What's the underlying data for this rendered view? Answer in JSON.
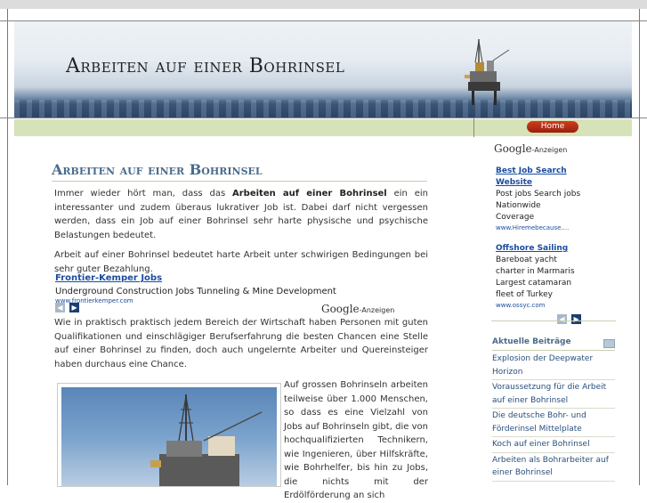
{
  "header": {
    "site_title": "Arbeiten auf einer Bohrinsel"
  },
  "nav": {
    "home_label": "Home"
  },
  "post": {
    "title": "Arbeiten auf einer Bohrinsel",
    "p1_before": "Immer wieder hört man, dass das ",
    "p1_bold": "Arbeiten auf einer Bohrinsel",
    "p1_after": " ein ein interessanter und zudem überaus lukrativer Job ist. Dabei darf nicht vergessen werden, dass ein Job auf einer Bohrinsel sehr harte physische und psychische Belastungen bedeutet.",
    "p2": "Arbeit auf einer Bohrinsel bedeutet harte Arbeit unter schwirigen Bedingungen bei sehr guter Bezahlung.",
    "p3": "Wie in praktisch praktisch jedem Bereich der Wirtschaft haben Personen mit guten Qualifikationen und einschlägiger Berufserfahrung die besten Chancen eine Stelle auf einer Bohrinsel zu finden, doch auch ungelernte Arbeiter und Quereinsteiger haben durchaus eine Chance.",
    "p4": "Auf grossen Bohrinseln arbeiten teilweise über 1.000 Menschen, so dass es eine Vielzahl von Jobs auf Bohrinseln gibt, die von hochqualifizierten Technikern, wie Ingenieren, über Hilfskräfte, wie Bohrhelfer, bis hin zu Jobs, die nichts mit der Erdölförderung an sich"
  },
  "inline_ad": {
    "title": "Frontier-Kemper Jobs",
    "description": "Underground Construction Jobs Tunneling & Mine Development",
    "url": "www.frontierkemper.com",
    "google_word": "Google",
    "google_suffix": "-Anzeigen"
  },
  "sidebar": {
    "google_word": "Google",
    "google_suffix": "-Anzeigen",
    "ads": [
      {
        "title": "Best Job Search Website",
        "desc": "Post jobs Search jobs Nationwide Coverage",
        "url": "www.Hiremebecause...."
      },
      {
        "title": "Offshore Sailing",
        "desc": "Bareboat yacht charter in Marmaris Largest catamaran fleet of Turkey",
        "url": "www.ossyc.com"
      }
    ],
    "recent_title": "Aktuelle Beiträge",
    "recent_posts": [
      "Explosion der Deepwater Horizon",
      "Voraussetzung für die Arbeit auf einer Bohrinsel",
      "Die deutsche Bohr- und Förderinsel Mittelplate",
      "Koch auf einer Bohrinsel",
      "Arbeiten als Bohrarbeiter auf einer Bohrinsel"
    ]
  },
  "colors": {
    "nav_bg": "#d6e2b7",
    "home_button": "#c0311a",
    "title_blue": "#4a6b8a",
    "link_blue": "#1a4c9e",
    "arrow_box": "#1d3d72"
  },
  "icons": {
    "prev": "chevron-left-icon",
    "next": "chevron-right-icon",
    "rss": "feed-icon"
  }
}
